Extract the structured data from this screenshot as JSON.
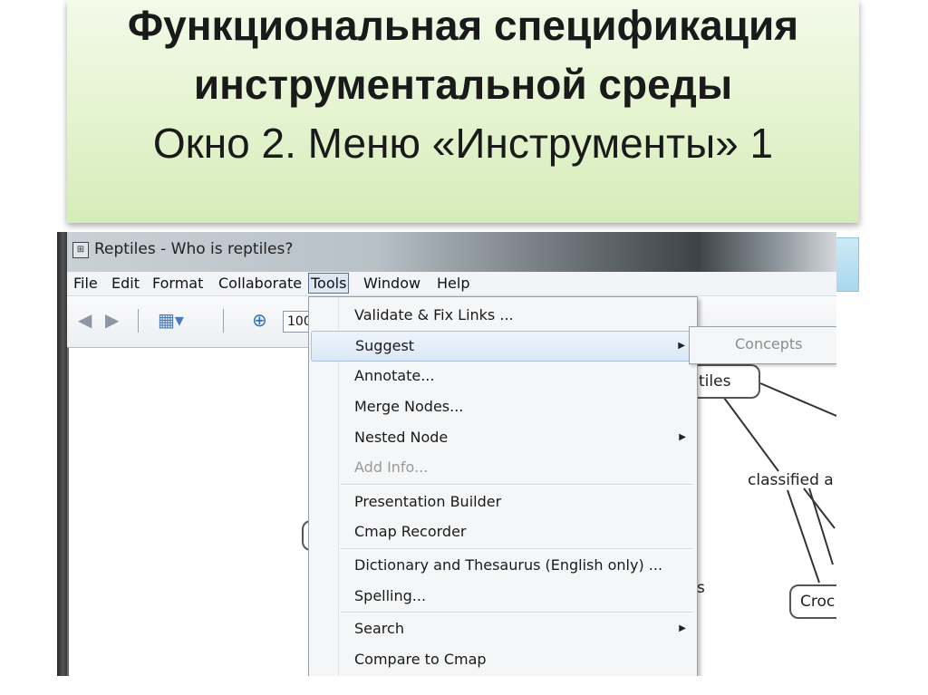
{
  "slide": {
    "title_line1": "Функциональная спецификация",
    "title_line2": "инструментальной среды",
    "title_line3": "Окно 2. Меню «Инструменты» 1"
  },
  "window": {
    "title": "Reptiles - Who is reptiles?"
  },
  "menubar": {
    "items": [
      "File",
      "Edit",
      "Format",
      "Collaborate",
      "Tools",
      "Window",
      "Help"
    ],
    "active": "Tools"
  },
  "toolbar": {
    "icons": [
      "back-arrow-icon",
      "forward-arrow-icon",
      "view-icon",
      "zoom-icon"
    ],
    "zoom_value": "100"
  },
  "tools_menu": {
    "items": [
      {
        "label": "Validate & Fix Links ...",
        "enabled": true,
        "submenu": false
      },
      {
        "label": "Suggest",
        "enabled": true,
        "submenu": true,
        "highlighted": true
      },
      {
        "label": "Annotate...",
        "enabled": true,
        "submenu": false
      },
      {
        "label": "Merge Nodes...",
        "enabled": true,
        "submenu": false
      },
      {
        "label": "Nested Node",
        "enabled": true,
        "submenu": true
      },
      {
        "label": "Add Info...",
        "enabled": false,
        "submenu": false
      },
      {
        "label": "Presentation Builder",
        "enabled": true,
        "submenu": false
      },
      {
        "label": "Cmap Recorder",
        "enabled": true,
        "submenu": false
      },
      {
        "label": "Dictionary and Thesaurus (English only) ...",
        "enabled": true,
        "submenu": false
      },
      {
        "label": "Spelling...",
        "enabled": true,
        "submenu": false
      },
      {
        "label": "Search",
        "enabled": true,
        "submenu": true
      },
      {
        "label": "Compare to Cmap",
        "enabled": true,
        "submenu": false
      }
    ]
  },
  "submenu": {
    "items": [
      {
        "label": "Concepts",
        "enabled": false
      }
    ]
  },
  "concept_map": {
    "node1": "tiles",
    "label1": "classified a",
    "node2": "Croc",
    "fragment": "s"
  }
}
